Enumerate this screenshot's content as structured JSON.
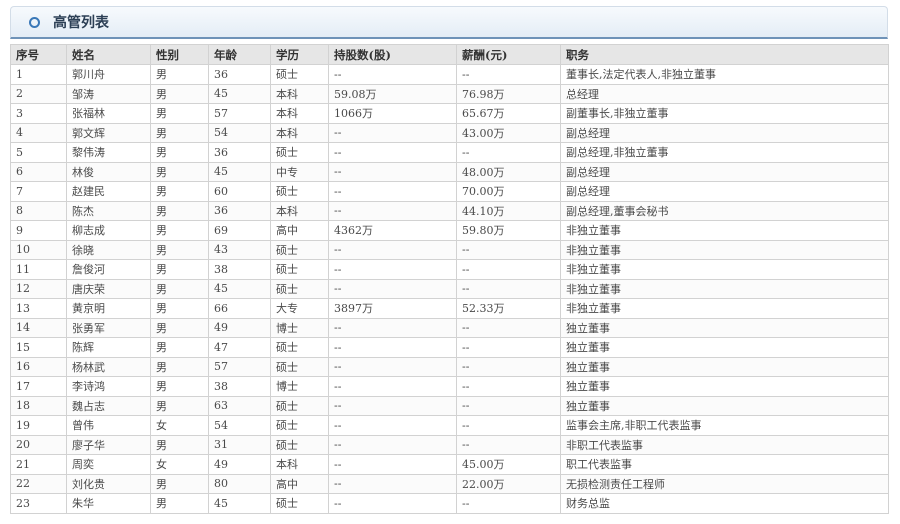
{
  "header": {
    "title": "高管列表",
    "icon": "circle-icon"
  },
  "table": {
    "columns": [
      "序号",
      "姓名",
      "性别",
      "年龄",
      "学历",
      "持股数(股)",
      "薪酬(元)",
      "职务"
    ],
    "rows": [
      [
        "1",
        "郭川舟",
        "男",
        "36",
        "硕士",
        "--",
        "--",
        "董事长,法定代表人,非独立董事"
      ],
      [
        "2",
        "邹涛",
        "男",
        "45",
        "本科",
        "59.08万",
        "76.98万",
        "总经理"
      ],
      [
        "3",
        "张福林",
        "男",
        "57",
        "本科",
        "1066万",
        "65.67万",
        "副董事长,非独立董事"
      ],
      [
        "4",
        "郭文辉",
        "男",
        "54",
        "本科",
        "--",
        "43.00万",
        "副总经理"
      ],
      [
        "5",
        "黎伟涛",
        "男",
        "36",
        "硕士",
        "--",
        "--",
        "副总经理,非独立董事"
      ],
      [
        "6",
        "林俊",
        "男",
        "45",
        "中专",
        "--",
        "48.00万",
        "副总经理"
      ],
      [
        "7",
        "赵建民",
        "男",
        "60",
        "硕士",
        "--",
        "70.00万",
        "副总经理"
      ],
      [
        "8",
        "陈杰",
        "男",
        "36",
        "本科",
        "--",
        "44.10万",
        "副总经理,董事会秘书"
      ],
      [
        "9",
        "柳志成",
        "男",
        "69",
        "高中",
        "4362万",
        "59.80万",
        "非独立董事"
      ],
      [
        "10",
        "徐晓",
        "男",
        "43",
        "硕士",
        "--",
        "--",
        "非独立董事"
      ],
      [
        "11",
        "詹俊河",
        "男",
        "38",
        "硕士",
        "--",
        "--",
        "非独立董事"
      ],
      [
        "12",
        "唐庆荣",
        "男",
        "45",
        "硕士",
        "--",
        "--",
        "非独立董事"
      ],
      [
        "13",
        "黄京明",
        "男",
        "66",
        "大专",
        "3897万",
        "52.33万",
        "非独立董事"
      ],
      [
        "14",
        "张勇军",
        "男",
        "49",
        "博士",
        "--",
        "--",
        "独立董事"
      ],
      [
        "15",
        "陈辉",
        "男",
        "47",
        "硕士",
        "--",
        "--",
        "独立董事"
      ],
      [
        "16",
        "杨林武",
        "男",
        "57",
        "硕士",
        "--",
        "--",
        "独立董事"
      ],
      [
        "17",
        "李诗鸿",
        "男",
        "38",
        "博士",
        "--",
        "--",
        "独立董事"
      ],
      [
        "18",
        "魏占志",
        "男",
        "63",
        "硕士",
        "--",
        "--",
        "独立董事"
      ],
      [
        "19",
        "曾伟",
        "女",
        "54",
        "硕士",
        "--",
        "--",
        "监事会主席,非职工代表监事"
      ],
      [
        "20",
        "廖子华",
        "男",
        "31",
        "硕士",
        "--",
        "--",
        "非职工代表监事"
      ],
      [
        "21",
        "周奕",
        "女",
        "49",
        "本科",
        "--",
        "45.00万",
        "职工代表监事"
      ],
      [
        "22",
        "刘化贵",
        "男",
        "80",
        "高中",
        "--",
        "22.00万",
        "无损检测责任工程师"
      ],
      [
        "23",
        "朱华",
        "男",
        "45",
        "硕士",
        "--",
        "--",
        "财务总监"
      ]
    ]
  }
}
